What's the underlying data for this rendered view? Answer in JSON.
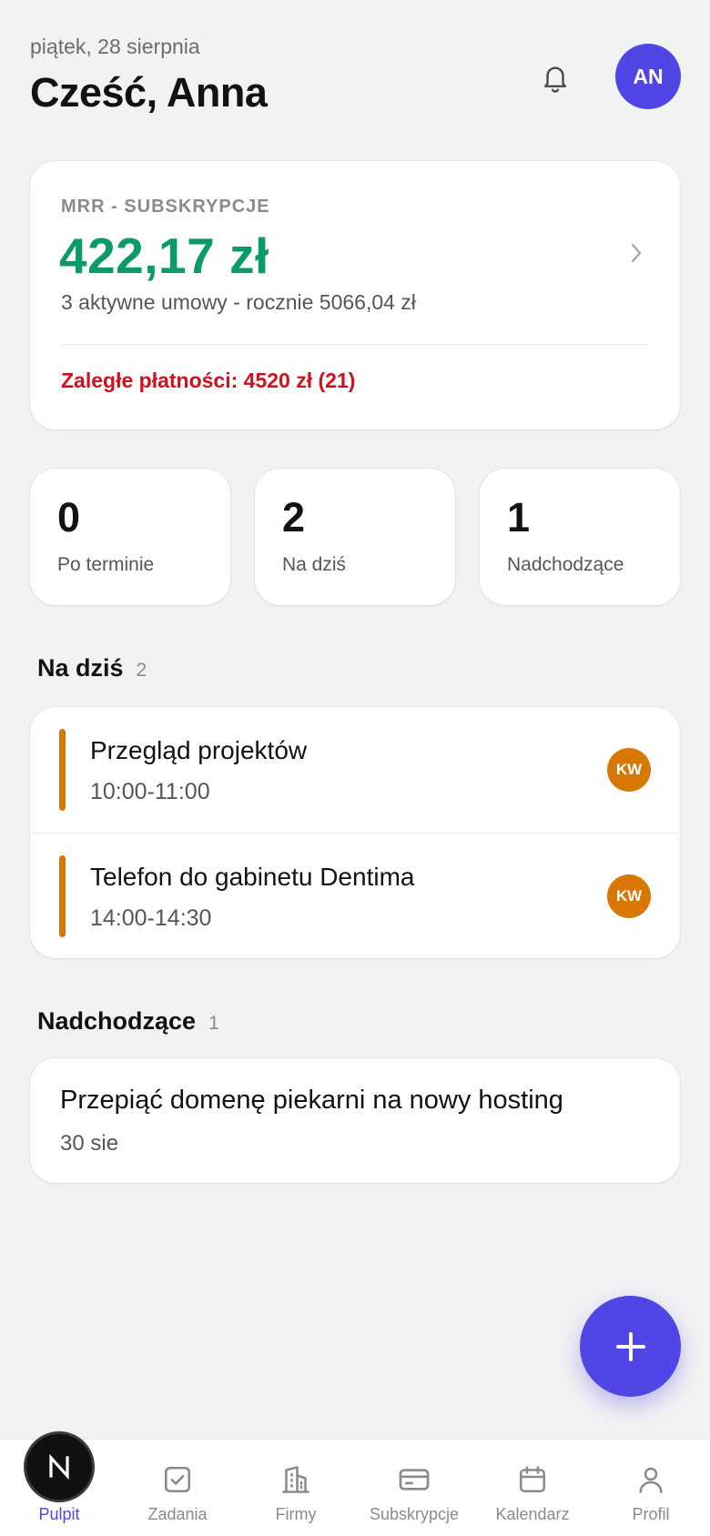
{
  "header": {
    "date": "piątek, 28 sierpnia",
    "greeting": "Cześć, Anna",
    "avatar_initials": "AN"
  },
  "mrr": {
    "label": "MRR - SUBSKRYPCJE",
    "amount": "422,17 zł",
    "subtitle": "3 aktywne umowy - rocznie 5066,04 zł",
    "overdue": "Zaległe płatności: 4520 zł (21)"
  },
  "stats": [
    {
      "value": "0",
      "label": "Po terminie"
    },
    {
      "value": "2",
      "label": "Na dziś"
    },
    {
      "value": "1",
      "label": "Nadchodzące"
    }
  ],
  "today": {
    "title": "Na dziś",
    "count": "2",
    "tasks": [
      {
        "title": "Przegląd projektów",
        "time": "10:00-11:00",
        "assignee": "KW"
      },
      {
        "title": "Telefon do gabinetu Dentima",
        "time": "14:00-14:30",
        "assignee": "KW"
      }
    ]
  },
  "upcoming": {
    "title": "Nadchodzące",
    "count": "1",
    "tasks": [
      {
        "title": "Przepiąć domenę piekarni na nowy hosting",
        "date": "30 sie"
      }
    ]
  },
  "tabs": [
    {
      "label": "Pulpit",
      "icon": "next-logo-icon",
      "active": true
    },
    {
      "label": "Zadania",
      "icon": "checkbox-icon"
    },
    {
      "label": "Firmy",
      "icon": "building-icon"
    },
    {
      "label": "Subskrypcje",
      "icon": "credit-card-icon"
    },
    {
      "label": "Kalendarz",
      "icon": "calendar-icon"
    },
    {
      "label": "Profil",
      "icon": "user-icon"
    }
  ],
  "colors": {
    "accent": "#4f46e5",
    "positive": "#0b9a6a",
    "danger": "#d0101c",
    "task": "#d97706"
  }
}
